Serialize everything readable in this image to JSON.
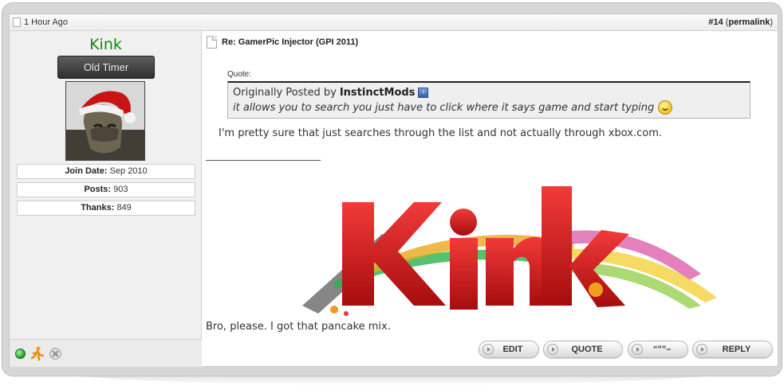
{
  "header": {
    "date": "1 Hour Ago",
    "post_number": "#14",
    "permalink_open": " (",
    "permalink": "permalink",
    "permalink_close": ")"
  },
  "user": {
    "name": "Kink",
    "title": "Old Timer",
    "join_date_label": "Join Date:",
    "join_date": "Sep 2010",
    "posts_label": "Posts:",
    "posts": "903",
    "thanks_label": "Thanks:",
    "thanks": "849",
    "status_icons": [
      "online-icon",
      "aim-icon",
      "xbox-live-icon"
    ]
  },
  "post": {
    "title": "Re: GamerPic Injector (GPI 2011)",
    "quote": {
      "label": "Quote:",
      "posted_by_prefix": "Originally Posted by",
      "author": "InstinctMods",
      "text": "it allows you to search you just have to click where it says game and start typing"
    },
    "body": "I'm pretty sure that just searches through the list and not actually through xbox.com.",
    "signature_text": "Bro, please. I got that pancake mix."
  },
  "actions": {
    "edit": "EDIT",
    "quote": "QUOTE",
    "multiquote": "“””–",
    "reply": "REPLY"
  },
  "colors": {
    "username": "#118b11",
    "title_badge": "#3f3f3f",
    "online": "#1c9a1c"
  }
}
